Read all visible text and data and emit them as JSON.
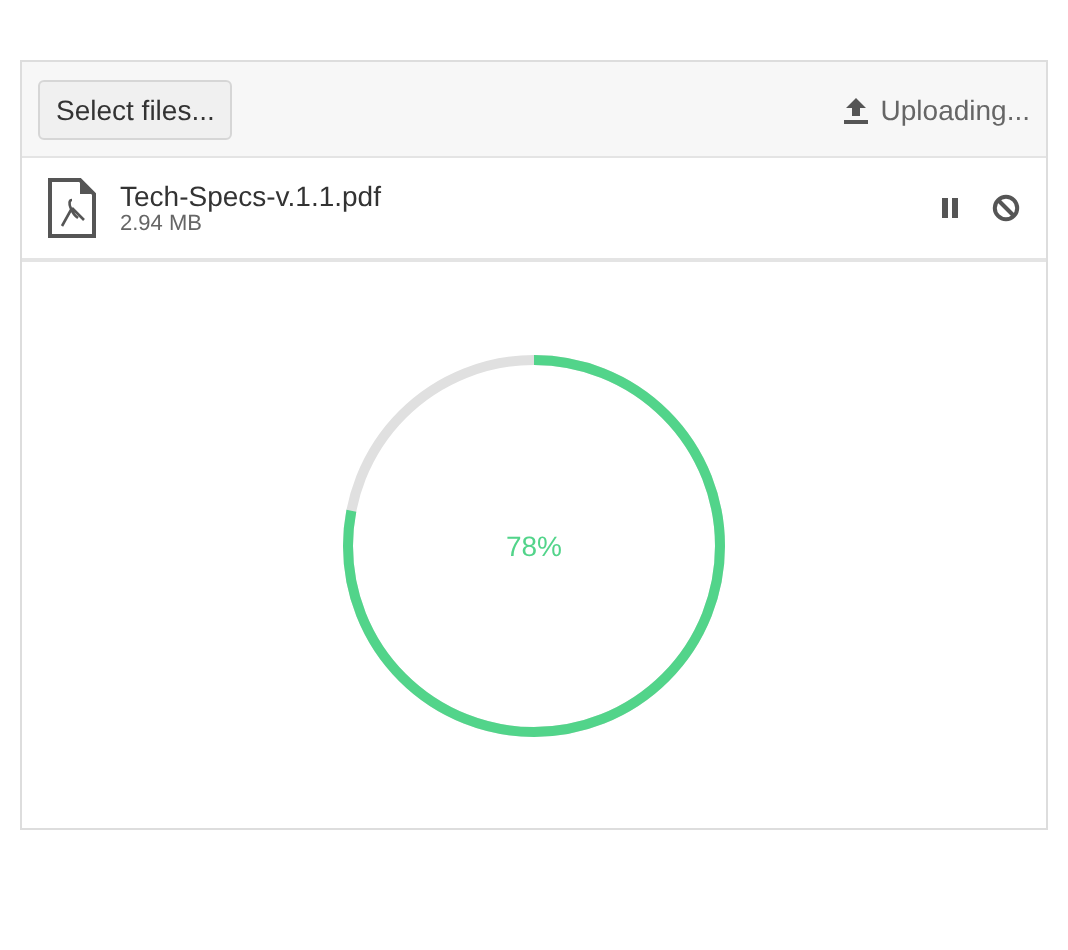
{
  "toolbar": {
    "select_button": "Select files...",
    "status": "Uploading..."
  },
  "file": {
    "name": "Tech-Specs-v.1.1.pdf",
    "size": "2.94 MB",
    "paused": false
  },
  "progress": {
    "reading": "78%"
  }
}
